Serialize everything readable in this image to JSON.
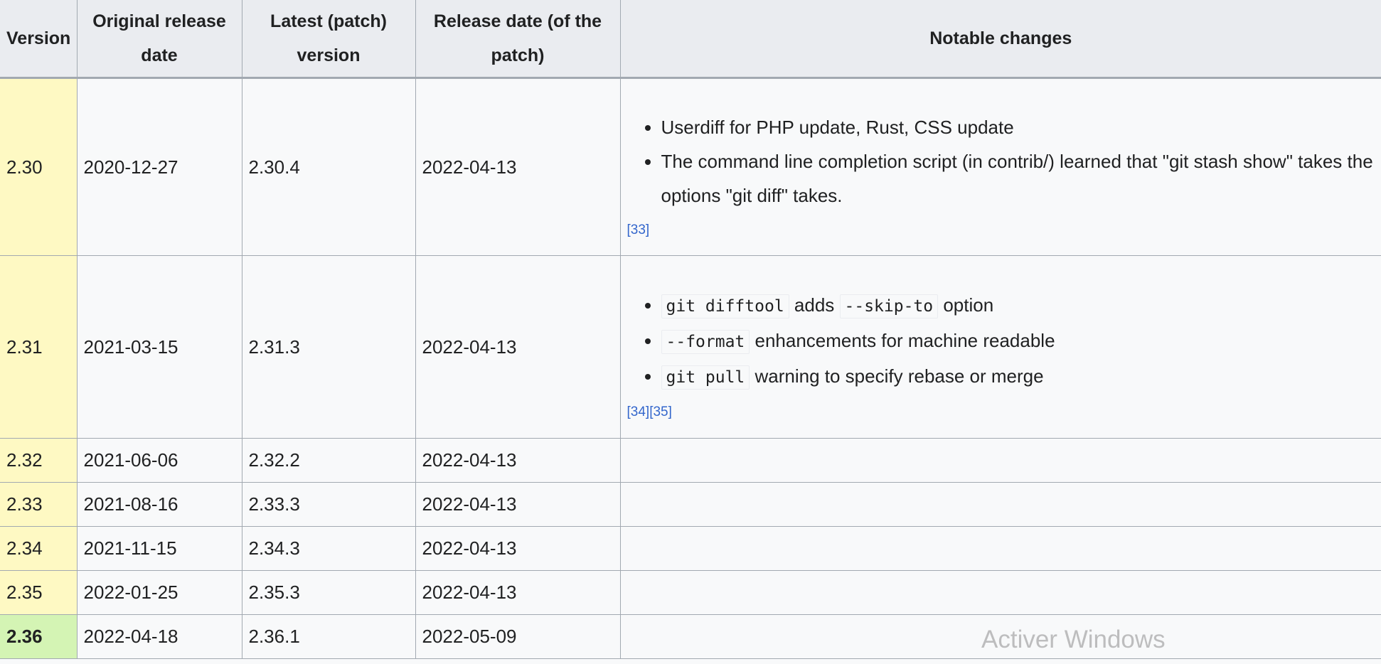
{
  "table": {
    "headers": {
      "version": "Version",
      "original_release_date": "Original release date",
      "latest_patch": "Latest (patch) version",
      "release_date_patch": "Release date (of the patch)",
      "notable_changes": "Notable changes"
    },
    "rows": [
      {
        "version": "2.30",
        "original": "2020-12-27",
        "latest": "2.30.4",
        "patch_date": "2022-04-13",
        "changes": [
          "Userdiff for PHP update, Rust, CSS update",
          "The command line completion script (in contrib/) learned that \"git stash show\" takes the options \"git diff\" takes."
        ],
        "refs": [
          "[33]"
        ]
      },
      {
        "version": "2.31",
        "original": "2021-03-15",
        "latest": "2.31.3",
        "patch_date": "2022-04-13",
        "changes_rich": [
          {
            "code1": "git difftool",
            "text1": " adds ",
            "code2": "--skip-to",
            "text2": " option"
          },
          {
            "code1": "--format",
            "text1": " enhancements for machine readable"
          },
          {
            "code1": "git pull",
            "text1": " warning to specify rebase or merge"
          }
        ],
        "refs": [
          "[34]",
          "[35]"
        ]
      },
      {
        "version": "2.32",
        "original": "2021-06-06",
        "latest": "2.32.2",
        "patch_date": "2022-04-13"
      },
      {
        "version": "2.33",
        "original": "2021-08-16",
        "latest": "2.33.3",
        "patch_date": "2022-04-13"
      },
      {
        "version": "2.34",
        "original": "2021-11-15",
        "latest": "2.34.3",
        "patch_date": "2022-04-13"
      },
      {
        "version": "2.35",
        "original": "2022-01-25",
        "latest": "2.35.3",
        "patch_date": "2022-04-13"
      },
      {
        "version": "2.36",
        "original": "2022-04-18",
        "latest": "2.36.1",
        "patch_date": "2022-05-09"
      }
    ]
  },
  "colors": {
    "old_version_bg": "#fef9c3",
    "current_version_bg": "#d4f4b4",
    "header_bg": "#eaecf0",
    "link": "#3366cc"
  },
  "watermark": "Activer Windows"
}
